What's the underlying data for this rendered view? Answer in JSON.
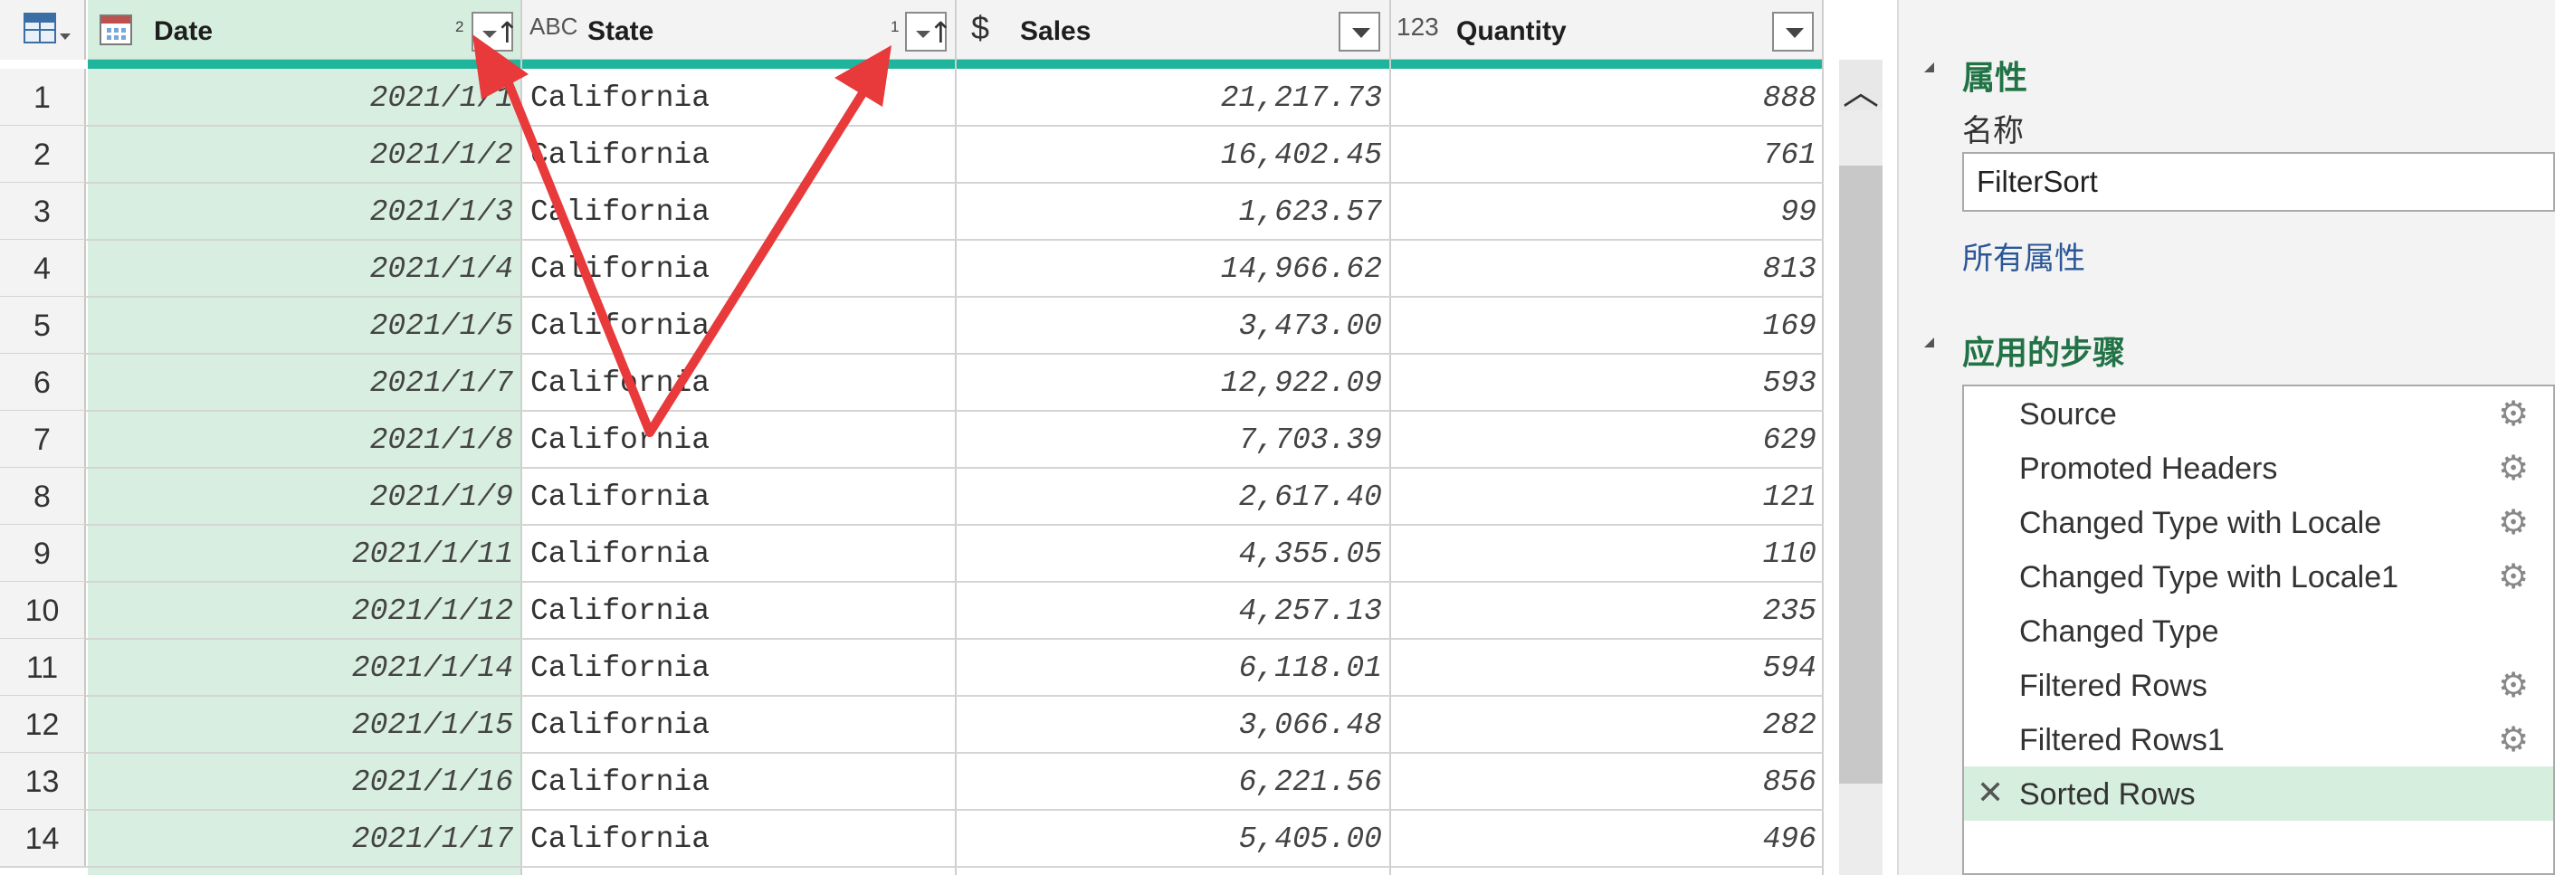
{
  "columns": [
    {
      "name": "Date",
      "type_icon": "calendar-icon",
      "sort_order": "2"
    },
    {
      "name": "State",
      "type_icon": "text-type-icon",
      "type_label": "ABC",
      "sort_order": "1"
    },
    {
      "name": "Sales",
      "type_icon": "currency-type-icon",
      "type_label": "$"
    },
    {
      "name": "Quantity",
      "type_icon": "integer-type-icon",
      "type_label": "123"
    }
  ],
  "rows": [
    {
      "n": "1",
      "date": "2021/1/1",
      "state": "California",
      "sales": "21,217.73",
      "qty": "888"
    },
    {
      "n": "2",
      "date": "2021/1/2",
      "state": "California",
      "sales": "16,402.45",
      "qty": "761"
    },
    {
      "n": "3",
      "date": "2021/1/3",
      "state": "California",
      "sales": "1,623.57",
      "qty": "99"
    },
    {
      "n": "4",
      "date": "2021/1/4",
      "state": "California",
      "sales": "14,966.62",
      "qty": "813"
    },
    {
      "n": "5",
      "date": "2021/1/5",
      "state": "California",
      "sales": "3,473.00",
      "qty": "169"
    },
    {
      "n": "6",
      "date": "2021/1/7",
      "state": "California",
      "sales": "12,922.09",
      "qty": "593"
    },
    {
      "n": "7",
      "date": "2021/1/8",
      "state": "California",
      "sales": "7,703.39",
      "qty": "629"
    },
    {
      "n": "8",
      "date": "2021/1/9",
      "state": "California",
      "sales": "2,617.40",
      "qty": "121"
    },
    {
      "n": "9",
      "date": "2021/1/11",
      "state": "California",
      "sales": "4,355.05",
      "qty": "110"
    },
    {
      "n": "10",
      "date": "2021/1/12",
      "state": "California",
      "sales": "4,257.13",
      "qty": "235"
    },
    {
      "n": "11",
      "date": "2021/1/14",
      "state": "California",
      "sales": "6,118.01",
      "qty": "594"
    },
    {
      "n": "12",
      "date": "2021/1/15",
      "state": "California",
      "sales": "3,066.48",
      "qty": "282"
    },
    {
      "n": "13",
      "date": "2021/1/16",
      "state": "California",
      "sales": "6,221.56",
      "qty": "856"
    },
    {
      "n": "14",
      "date": "2021/1/17",
      "state": "California",
      "sales": "5,405.00",
      "qty": "496"
    }
  ],
  "properties": {
    "title": "属性",
    "name_label": "名称",
    "name_value": "FilterSort",
    "all_props_link": "所有属性"
  },
  "applied_steps": {
    "title": "应用的步骤",
    "steps": [
      {
        "label": "Source",
        "has_gear": true
      },
      {
        "label": "Promoted Headers",
        "has_gear": true
      },
      {
        "label": "Changed Type with Locale",
        "has_gear": true
      },
      {
        "label": "Changed Type with Locale1",
        "has_gear": true
      },
      {
        "label": "Changed Type",
        "has_gear": false
      },
      {
        "label": "Filtered Rows",
        "has_gear": true
      },
      {
        "label": "Filtered Rows1",
        "has_gear": true
      },
      {
        "label": "Sorted Rows",
        "has_gear": false,
        "active": true
      }
    ]
  },
  "colors": {
    "accent_teal": "#1fb59c",
    "selected_green": "#d6eede",
    "section_green": "#217346",
    "annotation_red": "#e8393b"
  }
}
